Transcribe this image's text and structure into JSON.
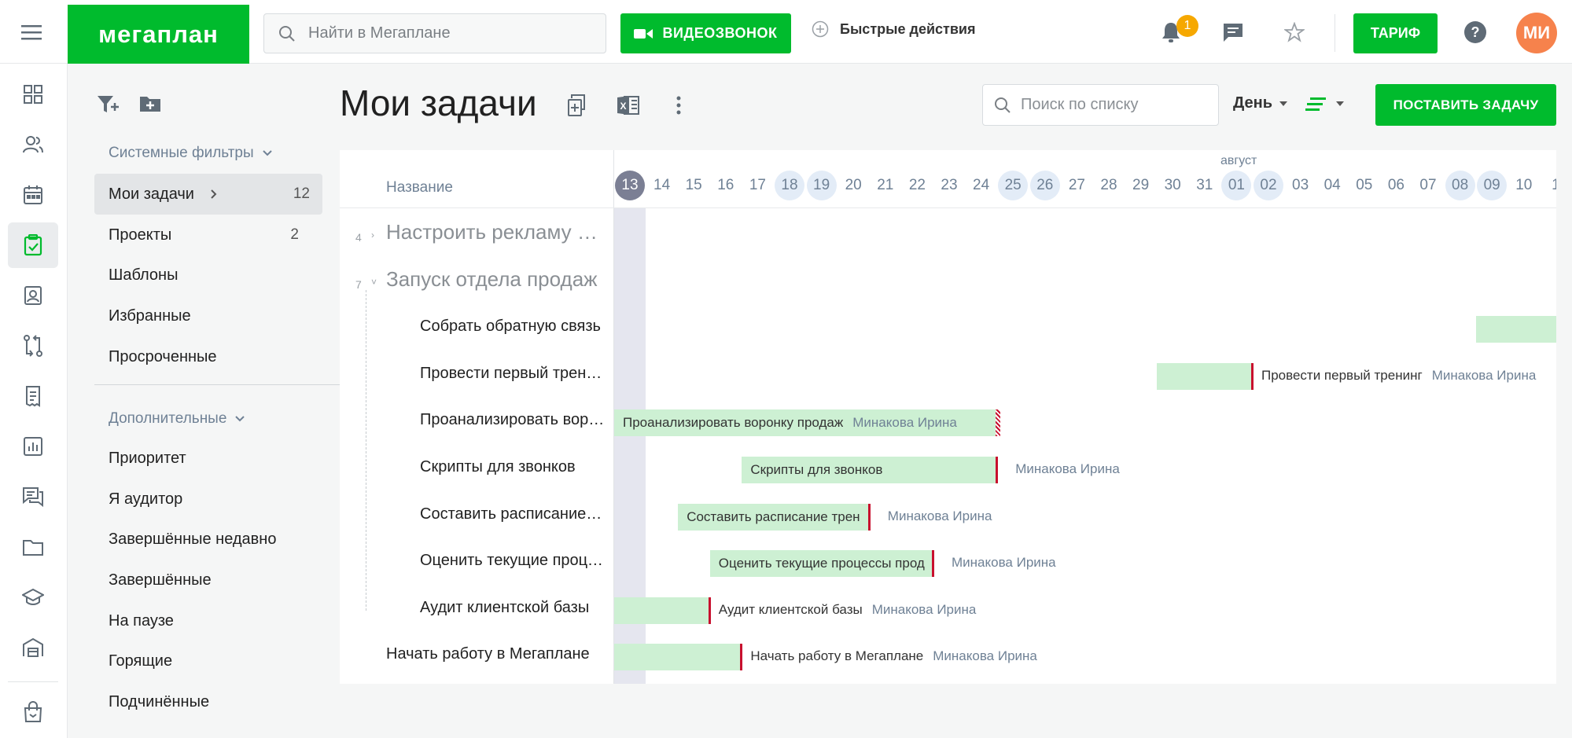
{
  "app": {
    "logo": "мегаплан",
    "search_placeholder": "Найти в Мегаплане",
    "video_button": "ВИДЕОЗВОНОК",
    "quick_actions": "Быстрые действия",
    "notifications_count": "1",
    "tariff_button": "ТАРИФ",
    "avatar_initials": "МИ",
    "accent_color": "#00bb2d"
  },
  "rail": {
    "icons": [
      "menu-icon",
      "dashboard-icon",
      "contacts-icon",
      "calendar-icon",
      "tasks-icon",
      "employees-icon",
      "deals-icon",
      "documents-icon",
      "reports-icon",
      "chat-icon",
      "files-icon",
      "learning-icon",
      "warehouse-icon",
      "shop-icon"
    ],
    "active": "tasks-icon"
  },
  "filters": {
    "system_title": "Системные фильтры",
    "system": [
      {
        "label": "Мои задачи",
        "count": "12"
      },
      {
        "label": "Проекты",
        "count": "2"
      },
      {
        "label": "Шаблоны",
        "count": ""
      },
      {
        "label": "Избранные",
        "count": ""
      },
      {
        "label": "Просроченные",
        "count": ""
      }
    ],
    "extra_title": "Дополнительные",
    "extra": [
      "Приоритет",
      "Я аудитор",
      "Завершённые недавно",
      "Завершённые",
      "На паузе",
      "Горящие",
      "Подчинённые"
    ]
  },
  "main": {
    "title": "Мои задачи",
    "list_search_placeholder": "Поиск по списку",
    "scale": "День",
    "add_task_button": "ПОСТАВИТЬ ЗАДАЧУ"
  },
  "gantt": {
    "name_header": "Название",
    "month_label": "август",
    "days": [
      "13",
      "14",
      "15",
      "16",
      "17",
      "18",
      "19",
      "20",
      "21",
      "22",
      "23",
      "24",
      "25",
      "26",
      "27",
      "28",
      "29",
      "30",
      "31",
      "01",
      "02",
      "03",
      "04",
      "05",
      "06",
      "07",
      "08",
      "09",
      "10",
      "1"
    ],
    "weekend_days": [
      5,
      6,
      12,
      13,
      19,
      20,
      26,
      27
    ],
    "today_index": 0,
    "rows": [
      {
        "num": "4",
        "arrow": "›",
        "name": "Настроить рекламу в соцсетях",
        "level": "parent"
      },
      {
        "num": "7",
        "arrow": "˅",
        "name": "Запуск отдела продаж",
        "level": "parent"
      },
      {
        "name": "Собрать обратную связь",
        "level": "child"
      },
      {
        "name": "Провести первый тренинг",
        "level": "child"
      },
      {
        "name": "Проанализировать воронку продаж",
        "level": "child"
      },
      {
        "name": "Скрипты для звонков",
        "level": "child"
      },
      {
        "name": "Составить расписание тренингов",
        "level": "child"
      },
      {
        "name": "Оценить текущие процессы продаж",
        "level": "child"
      },
      {
        "name": "Аудит клиентской базы",
        "level": "child"
      },
      {
        "name": "Начать работу в Мегаплане",
        "level": "top"
      }
    ],
    "bars": [
      {
        "row": 2,
        "start": 27.0,
        "end": 29.6,
        "label": "",
        "outside": "",
        "assignee": ""
      },
      {
        "row": 3,
        "start": 17.0,
        "end": 20.0,
        "label": "",
        "outside": "Провести первый тренинг",
        "assignee": "Минакова Ирина"
      },
      {
        "row": 4,
        "start": 0.0,
        "end": 12.0,
        "label": "Проанализировать воронку продаж",
        "inside_assignee": "Минакова Ирина",
        "deadline_style": "checker"
      },
      {
        "row": 5,
        "start": 4.0,
        "end": 12.0,
        "label": "Скрипты для звонков",
        "assignee": "Минакова Ирина"
      },
      {
        "row": 6,
        "start": 2.0,
        "end": 8.0,
        "label": "Составить расписание трен",
        "assignee": "Минакова Ирина"
      },
      {
        "row": 7,
        "start": 3.0,
        "end": 10.0,
        "label": "Оценить текущие процессы прод",
        "assignee": "Минакова Ирина"
      },
      {
        "row": 8,
        "start": 0.0,
        "end": 3.0,
        "label": "",
        "outside": "Аудит клиентской базы",
        "assignee": "Минакова Ирина"
      },
      {
        "row": 9,
        "start": 0.0,
        "end": 4.0,
        "label": "",
        "outside": "Начать работу в Мегаплане",
        "assignee": "Минакова Ирина"
      }
    ]
  }
}
